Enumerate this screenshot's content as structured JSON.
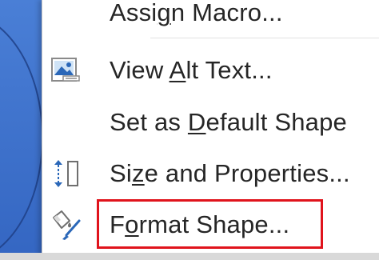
{
  "context_menu": {
    "items": [
      {
        "id": "assign-macro",
        "pre": "Assi",
        "key": "g",
        "post": "n Macro...",
        "icon": "none"
      },
      {
        "id": "view-alt-text",
        "pre": "View ",
        "key": "A",
        "post": "lt Text...",
        "icon": "alt-text-icon"
      },
      {
        "id": "set-default-shape",
        "pre": "Set as ",
        "key": "D",
        "post": "efault Shape",
        "icon": "none"
      },
      {
        "id": "size-and-properties",
        "pre": "Si",
        "key": "z",
        "post": "e and Properties...",
        "icon": "size-properties-icon"
      },
      {
        "id": "format-shape",
        "pre": "F",
        "key": "o",
        "post": "rmat Shape...",
        "icon": "paint-bucket-brush-icon"
      }
    ]
  },
  "highlight": {
    "color": "#e0131c",
    "target": "format-shape"
  },
  "colors": {
    "background_blue": "#3c6fc7",
    "menu_bg": "#ffffff",
    "text": "#262626"
  }
}
